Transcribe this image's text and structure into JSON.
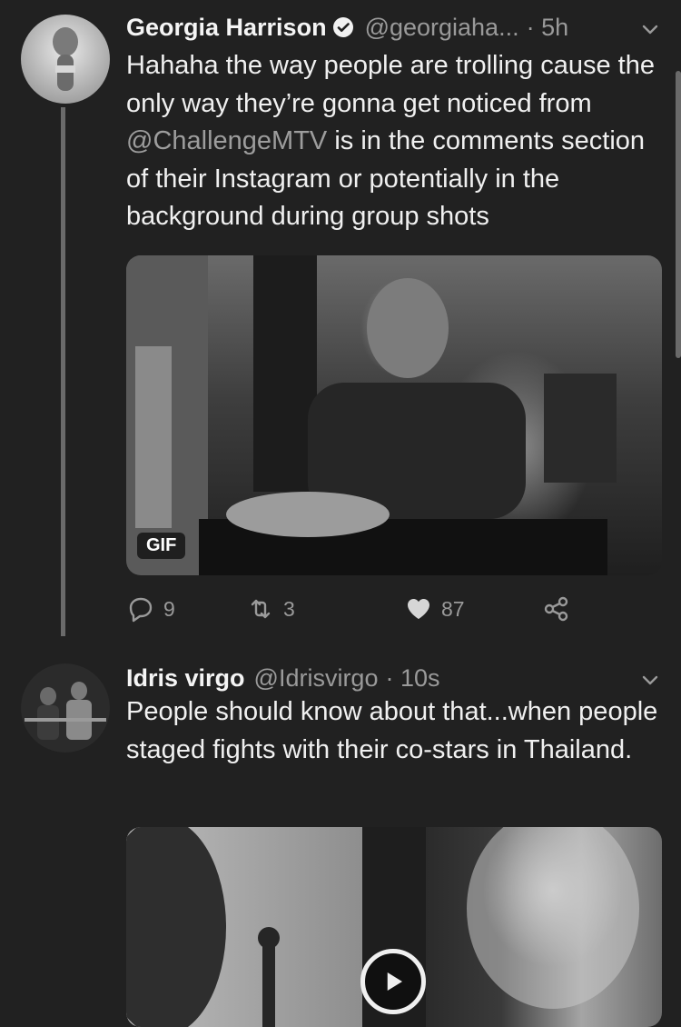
{
  "tweets": [
    {
      "name": "Georgia Harrison",
      "verified": true,
      "handle": "@georgiaha...",
      "time": "· 5h",
      "text_before": "Hahaha the way people are trolling cause the only way they’re gonna get noticed from ",
      "mention": "@ChallengeMTV",
      "text_after": " is in the comments section of their Instagram or potentially in the background during group shots",
      "media": {
        "type": "gif",
        "badge": "GIF"
      },
      "stats": {
        "replies": "9",
        "retweets": "3",
        "likes": "87"
      }
    },
    {
      "name": "Idris virgo",
      "verified": false,
      "handle": "@Idrisvirgo",
      "time": "· 10s",
      "text": "People should know about that...when people staged fights with their co-stars in Thailand.",
      "media": {
        "type": "video"
      }
    }
  ],
  "icons": {
    "verified": "verified-badge-icon",
    "chevron": "chevron-down-icon",
    "reply": "reply-icon",
    "retweet": "retweet-icon",
    "like": "heart-icon",
    "share": "share-icon",
    "play": "play-icon"
  },
  "colors": {
    "background": "#212121",
    "text": "#f2f2f2",
    "muted": "#9a9a9a"
  }
}
